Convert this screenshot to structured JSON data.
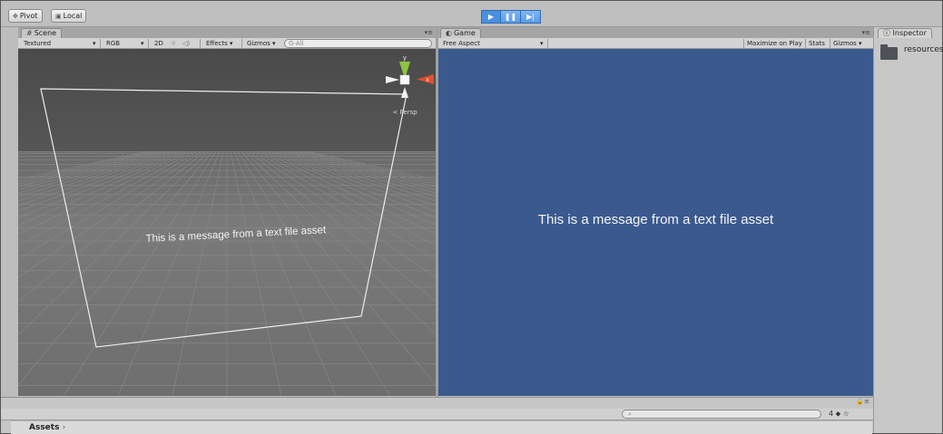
{
  "toolbar": {
    "pivot_label": "Pivot",
    "local_label": "Local",
    "play_icon": "play-icon",
    "pause_icon": "pause-icon",
    "step_icon": "step-icon"
  },
  "scene": {
    "tab_label": "Scene",
    "shading_mode": "Textured",
    "render_mode": "RGB",
    "mode_2d": "2D",
    "effects_label": "Effects",
    "gizmos_label": "Gizmos",
    "search_placeholder": "G-All",
    "gizmo_y_label": "y",
    "gizmo_x_label": "x",
    "persp_label": "< Persp",
    "canvas_text": "This is a message from a text file asset"
  },
  "game": {
    "tab_label": "Game",
    "aspect_label": "Free Aspect",
    "maximize_label": "Maximize on Play",
    "stats_label": "Stats",
    "gizmos_label": "Gizmos",
    "message": "This is a message from a text file asset",
    "background_color": "#3a5a8e"
  },
  "inspector": {
    "tab_label": "Inspector",
    "item_name": "resources"
  },
  "project": {
    "breadcrumb": "Assets",
    "icon_count": "4"
  },
  "colors": {
    "play_active": "#4a8fe0",
    "scene_bg": "#4c4c4c",
    "game_bg": "#3a5a8e"
  }
}
